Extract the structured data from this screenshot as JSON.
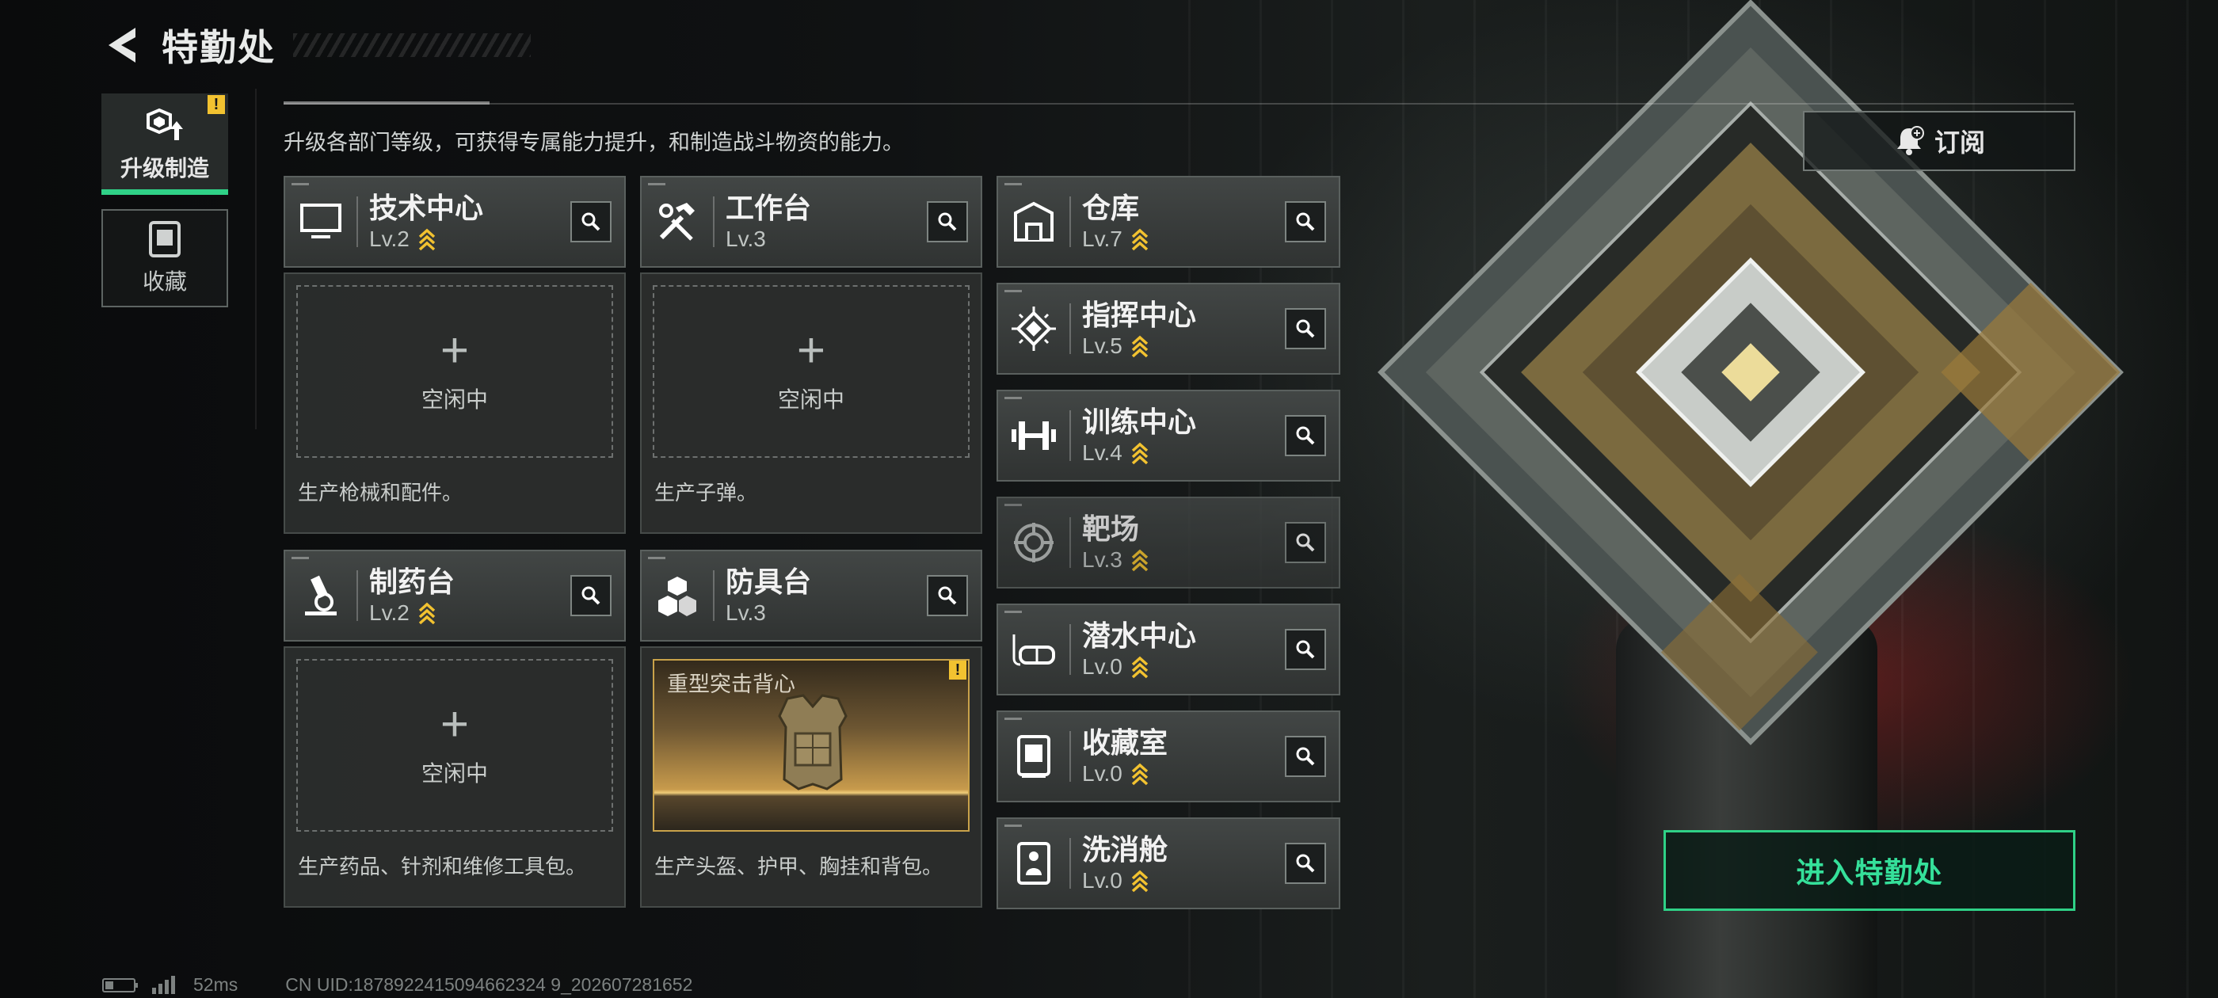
{
  "header": {
    "title": "特勤处"
  },
  "nav": [
    {
      "label": "升级制造",
      "icon": "upgrade-icon",
      "badge": "!"
    },
    {
      "label": "收藏",
      "icon": "collection-icon"
    }
  ],
  "description": "升级各部门等级，可获得专属能力提升，和制造战斗物资的能力。",
  "subscribe": {
    "label": "订阅",
    "icon": "bell-plus-icon"
  },
  "production_departments": [
    {
      "name": "技术中心",
      "level": "Lv.2",
      "upgradable": true,
      "icon": "monitor-icon",
      "slot": {
        "plus": "+",
        "label": "空闲中"
      },
      "desc": "生产枪械和配件。"
    },
    {
      "name": "工作台",
      "level": "Lv.3",
      "upgradable": false,
      "icon": "tools-icon",
      "slot": {
        "plus": "+",
        "label": "空闲中"
      },
      "desc": "生产子弹。"
    },
    {
      "name": "制药台",
      "level": "Lv.2",
      "upgradable": true,
      "icon": "microscope-icon",
      "slot": {
        "plus": "+",
        "label": "空闲中"
      },
      "desc": "生产药品、针剂和维修工具包。"
    },
    {
      "name": "防具台",
      "level": "Lv.3",
      "upgradable": false,
      "icon": "armor-blocks-icon",
      "slot_item": {
        "name": "重型突击背心",
        "badge": "!",
        "icon": "vest-icon"
      },
      "desc": "生产头盔、护甲、胸挂和背包。"
    }
  ],
  "departments": [
    {
      "name": "仓库",
      "level": "Lv.7",
      "upgradable": true,
      "icon": "warehouse-icon"
    },
    {
      "name": "指挥中心",
      "level": "Lv.5",
      "upgradable": true,
      "icon": "chip-icon"
    },
    {
      "name": "训练中心",
      "level": "Lv.4",
      "upgradable": true,
      "icon": "dumbbell-icon"
    },
    {
      "name": "靶场",
      "level": "Lv.3",
      "upgradable": true,
      "icon": "target-icon"
    },
    {
      "name": "潜水中心",
      "level": "Lv.0",
      "upgradable": true,
      "icon": "diving-mask-icon"
    },
    {
      "name": "收藏室",
      "level": "Lv.0",
      "upgradable": true,
      "icon": "collection-room-icon"
    },
    {
      "name": "洗消舱",
      "level": "Lv.0",
      "upgradable": true,
      "icon": "decon-icon"
    }
  ],
  "enter_button": {
    "label": "进入特勤处"
  },
  "status": {
    "ping": "52ms",
    "uid": "CN UID:1878922415094662324 9_202607281652"
  },
  "colors": {
    "accent_green": "#2fd187",
    "upgrade_gold": "#f2c230",
    "warning_yellow": "#f2c230",
    "panel_bg": "#2c2f2e"
  }
}
